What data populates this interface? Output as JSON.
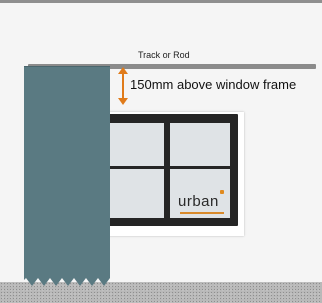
{
  "labels": {
    "track": "Track or Rod",
    "measurement": "150mm above window frame"
  },
  "logo": {
    "text": "urban"
  },
  "colors": {
    "curtain": "#5a7a82",
    "arrow": "#e07b1a",
    "frame": "#252525",
    "glass": "#dfe3e6",
    "track": "#8b8b8b"
  }
}
